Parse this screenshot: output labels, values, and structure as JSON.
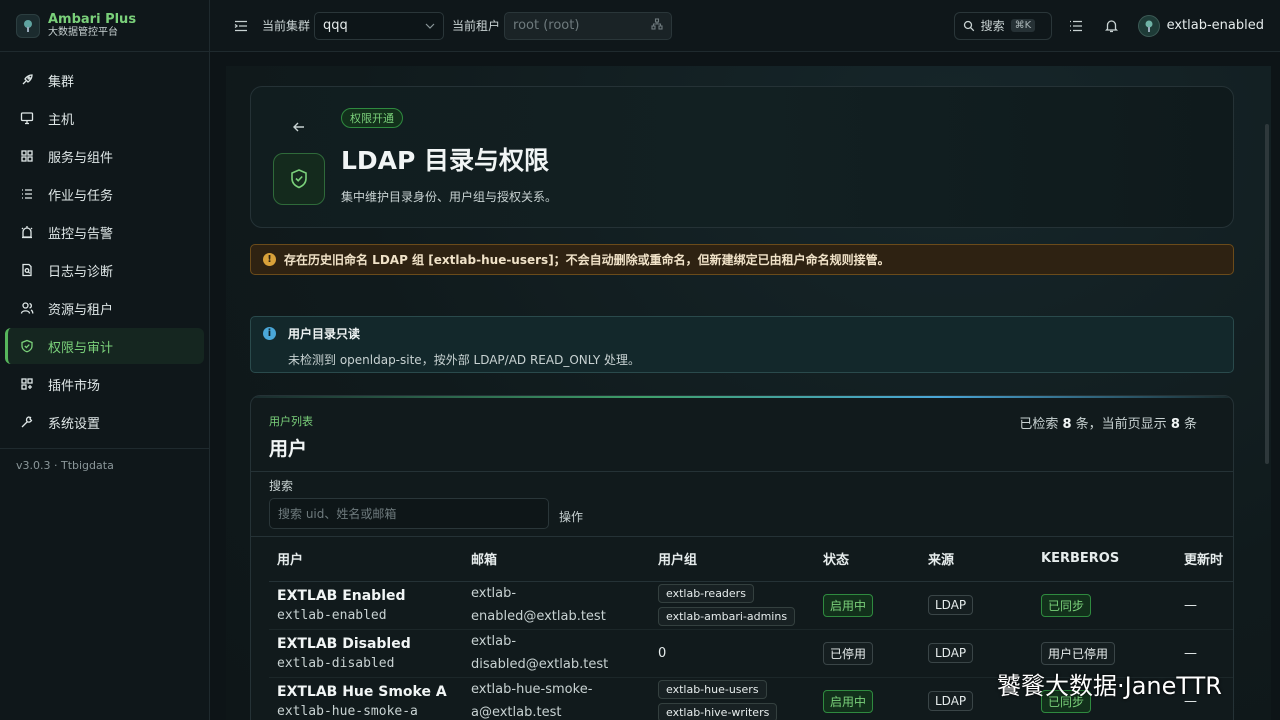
{
  "brand": {
    "title": "Ambari Plus",
    "subtitle": "大数据管控平台"
  },
  "sidebar": {
    "items": [
      {
        "label": "集群",
        "icon": "rocket-icon"
      },
      {
        "label": "主机",
        "icon": "monitor-icon"
      },
      {
        "label": "服务与组件",
        "icon": "grid-icon"
      },
      {
        "label": "作业与任务",
        "icon": "list-icon"
      },
      {
        "label": "监控与告警",
        "icon": "alarm-icon"
      },
      {
        "label": "日志与诊断",
        "icon": "file-search-icon"
      },
      {
        "label": "资源与租户",
        "icon": "users-icon"
      },
      {
        "label": "权限与审计",
        "icon": "shield-icon",
        "active": true
      },
      {
        "label": "插件市场",
        "icon": "puzzle-icon"
      },
      {
        "label": "系统设置",
        "icon": "wrench-icon"
      }
    ],
    "version": "v3.0.3 · Ttbigdata"
  },
  "header": {
    "cluster_label": "当前集群",
    "cluster_value": "qqq",
    "tenant_label": "当前租户",
    "tenant_value": "root (root)",
    "search_label": "搜索",
    "search_shortcut": "⌘K",
    "username": "extlab-enabled"
  },
  "hero": {
    "badge": "权限开通",
    "title": "LDAP 目录与权限",
    "description": "集中维护目录身份、用户组与授权关系。"
  },
  "warning": {
    "text": "存在历史旧命名 LDAP 组 [extlab-hue-users]；不会自动删除或重命名，但新建绑定已由租户命名规则接管。"
  },
  "info": {
    "title": "用户目录只读",
    "description": "未检测到 openldap-site，按外部 LDAP/AD READ_ONLY 处理。"
  },
  "users_card": {
    "kicker": "用户列表",
    "title": "用户",
    "count_prefix": "已检索 ",
    "count_total": "8",
    "count_mid": " 条，当前页显示 ",
    "count_shown": "8",
    "count_suffix": " 条",
    "search_label": "搜索",
    "search_placeholder": "搜索 uid、姓名或邮箱",
    "operations_label": "操作",
    "columns": [
      "用户",
      "邮箱",
      "用户组",
      "状态",
      "来源",
      "KERBEROS",
      "更新时"
    ],
    "rows": [
      {
        "name": "EXTLAB Enabled",
        "uid": "extlab-enabled",
        "email_line1": "extlab-",
        "email_line2": "enabled@extlab.test",
        "groups": [
          "extlab-readers",
          "extlab-ambari-admins"
        ],
        "status": "启用中",
        "source": "LDAP",
        "kerberos": "已同步",
        "updated": "—"
      },
      {
        "name": "EXTLAB Disabled",
        "uid": "extlab-disabled",
        "email_line1": "extlab-",
        "email_line2": "disabled@extlab.test",
        "groups_count": "0",
        "status": "已停用",
        "source": "LDAP",
        "kerberos": "用户已停用",
        "updated": "—"
      },
      {
        "name": "EXTLAB Hue Smoke A",
        "uid": "extlab-hue-smoke-a",
        "email_line1": "extlab-hue-smoke-",
        "email_line2": "a@extlab.test",
        "groups": [
          "extlab-hue-users",
          "extlab-hive-writers"
        ],
        "status": "启用中",
        "source": "LDAP",
        "kerberos": "已同步",
        "updated": "—"
      }
    ]
  },
  "watermark": "饕餮大数据·JaneTTR",
  "colors": {
    "accent": "#7ad07a",
    "warning": "#d8a13a",
    "info": "#4aa7d8",
    "background": "#0d1417"
  }
}
